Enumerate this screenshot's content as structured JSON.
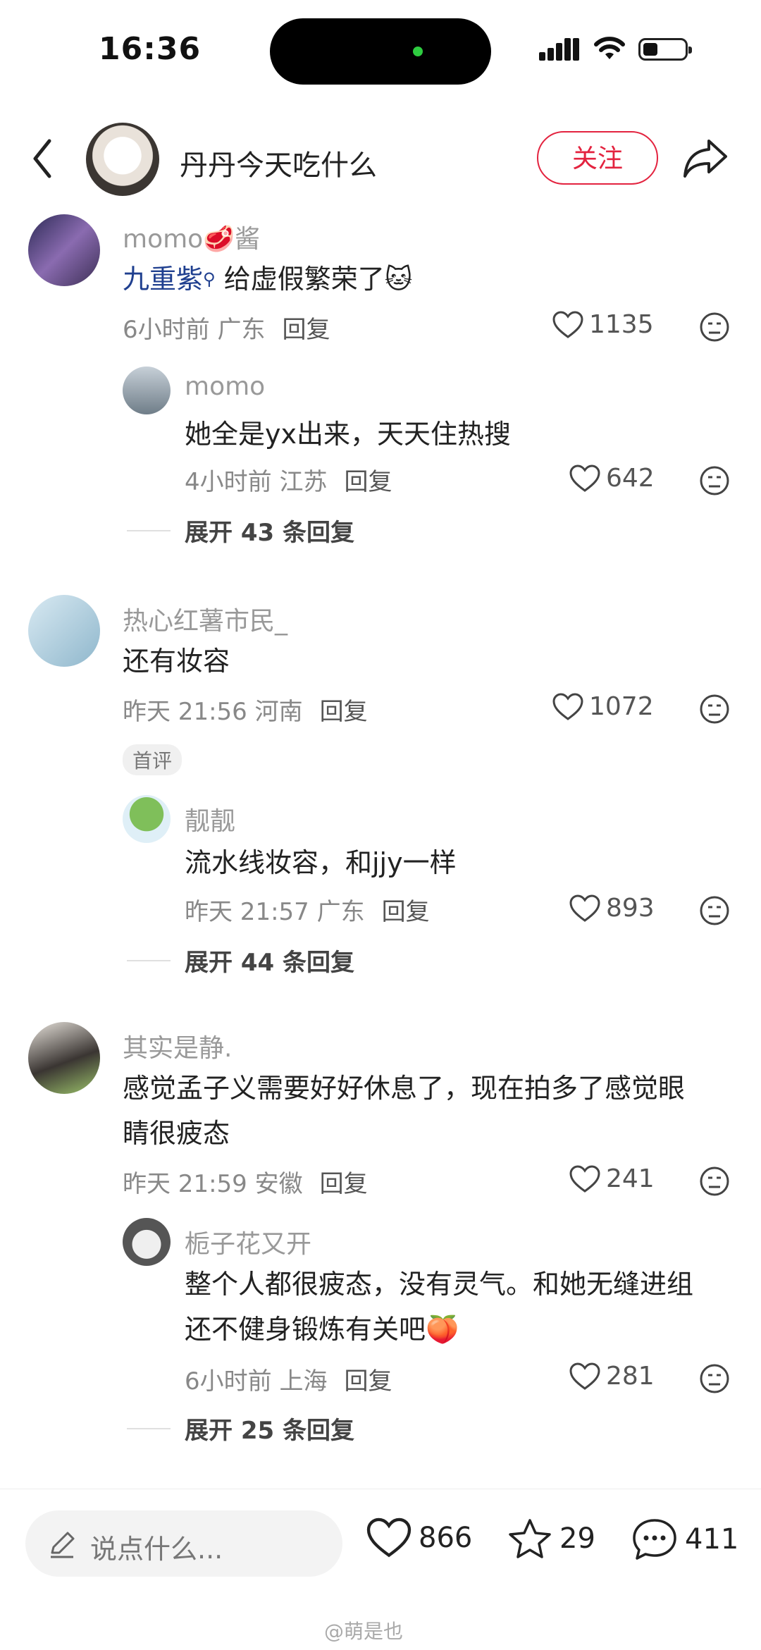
{
  "status": {
    "time": "16:36"
  },
  "header": {
    "title": "丹丹今天吃什么",
    "follow": "关注"
  },
  "comments": [
    {
      "user": "momo",
      "user_suffix": "酱",
      "mention": "九重紫",
      "text": "给虚假繁荣了",
      "meta": "6小时前 广东",
      "reply": "回复",
      "likes": "1135",
      "sub": {
        "user": "momo",
        "text": "她全是yx出来，天天住热搜",
        "meta": "4小时前 江苏",
        "reply": "回复",
        "likes": "642"
      },
      "expand": "展开 43 条回复"
    },
    {
      "user": "热心红薯市民_",
      "text": "还有妆容",
      "meta": "昨天 21:56 河南",
      "reply": "回复",
      "likes": "1072",
      "badge": "首评",
      "sub": {
        "user": "靓靓",
        "text": "流水线妆容，和jjy一样",
        "meta": "昨天 21:57 广东",
        "reply": "回复",
        "likes": "893"
      },
      "expand": "展开 44 条回复"
    },
    {
      "user": "其实是静.",
      "text_line1": "感觉孟子义需要好好休息了，现在拍多了感觉眼",
      "text_line2": "睛很疲态",
      "meta": "昨天 21:59 安徽",
      "reply": "回复",
      "likes": "241",
      "sub": {
        "user": "栀子花又开",
        "text_line1": "整个人都很疲态，没有灵气。和她无缝进组",
        "text_line2": "还不健身锻炼有关吧",
        "meta": "6小时前 上海",
        "reply": "回复",
        "likes": "281"
      },
      "expand": "展开 25 条回复"
    }
  ],
  "bottom": {
    "placeholder": "说点什么...",
    "likes": "866",
    "stars": "29",
    "comments": "411",
    "watermark": "@萌是也"
  }
}
